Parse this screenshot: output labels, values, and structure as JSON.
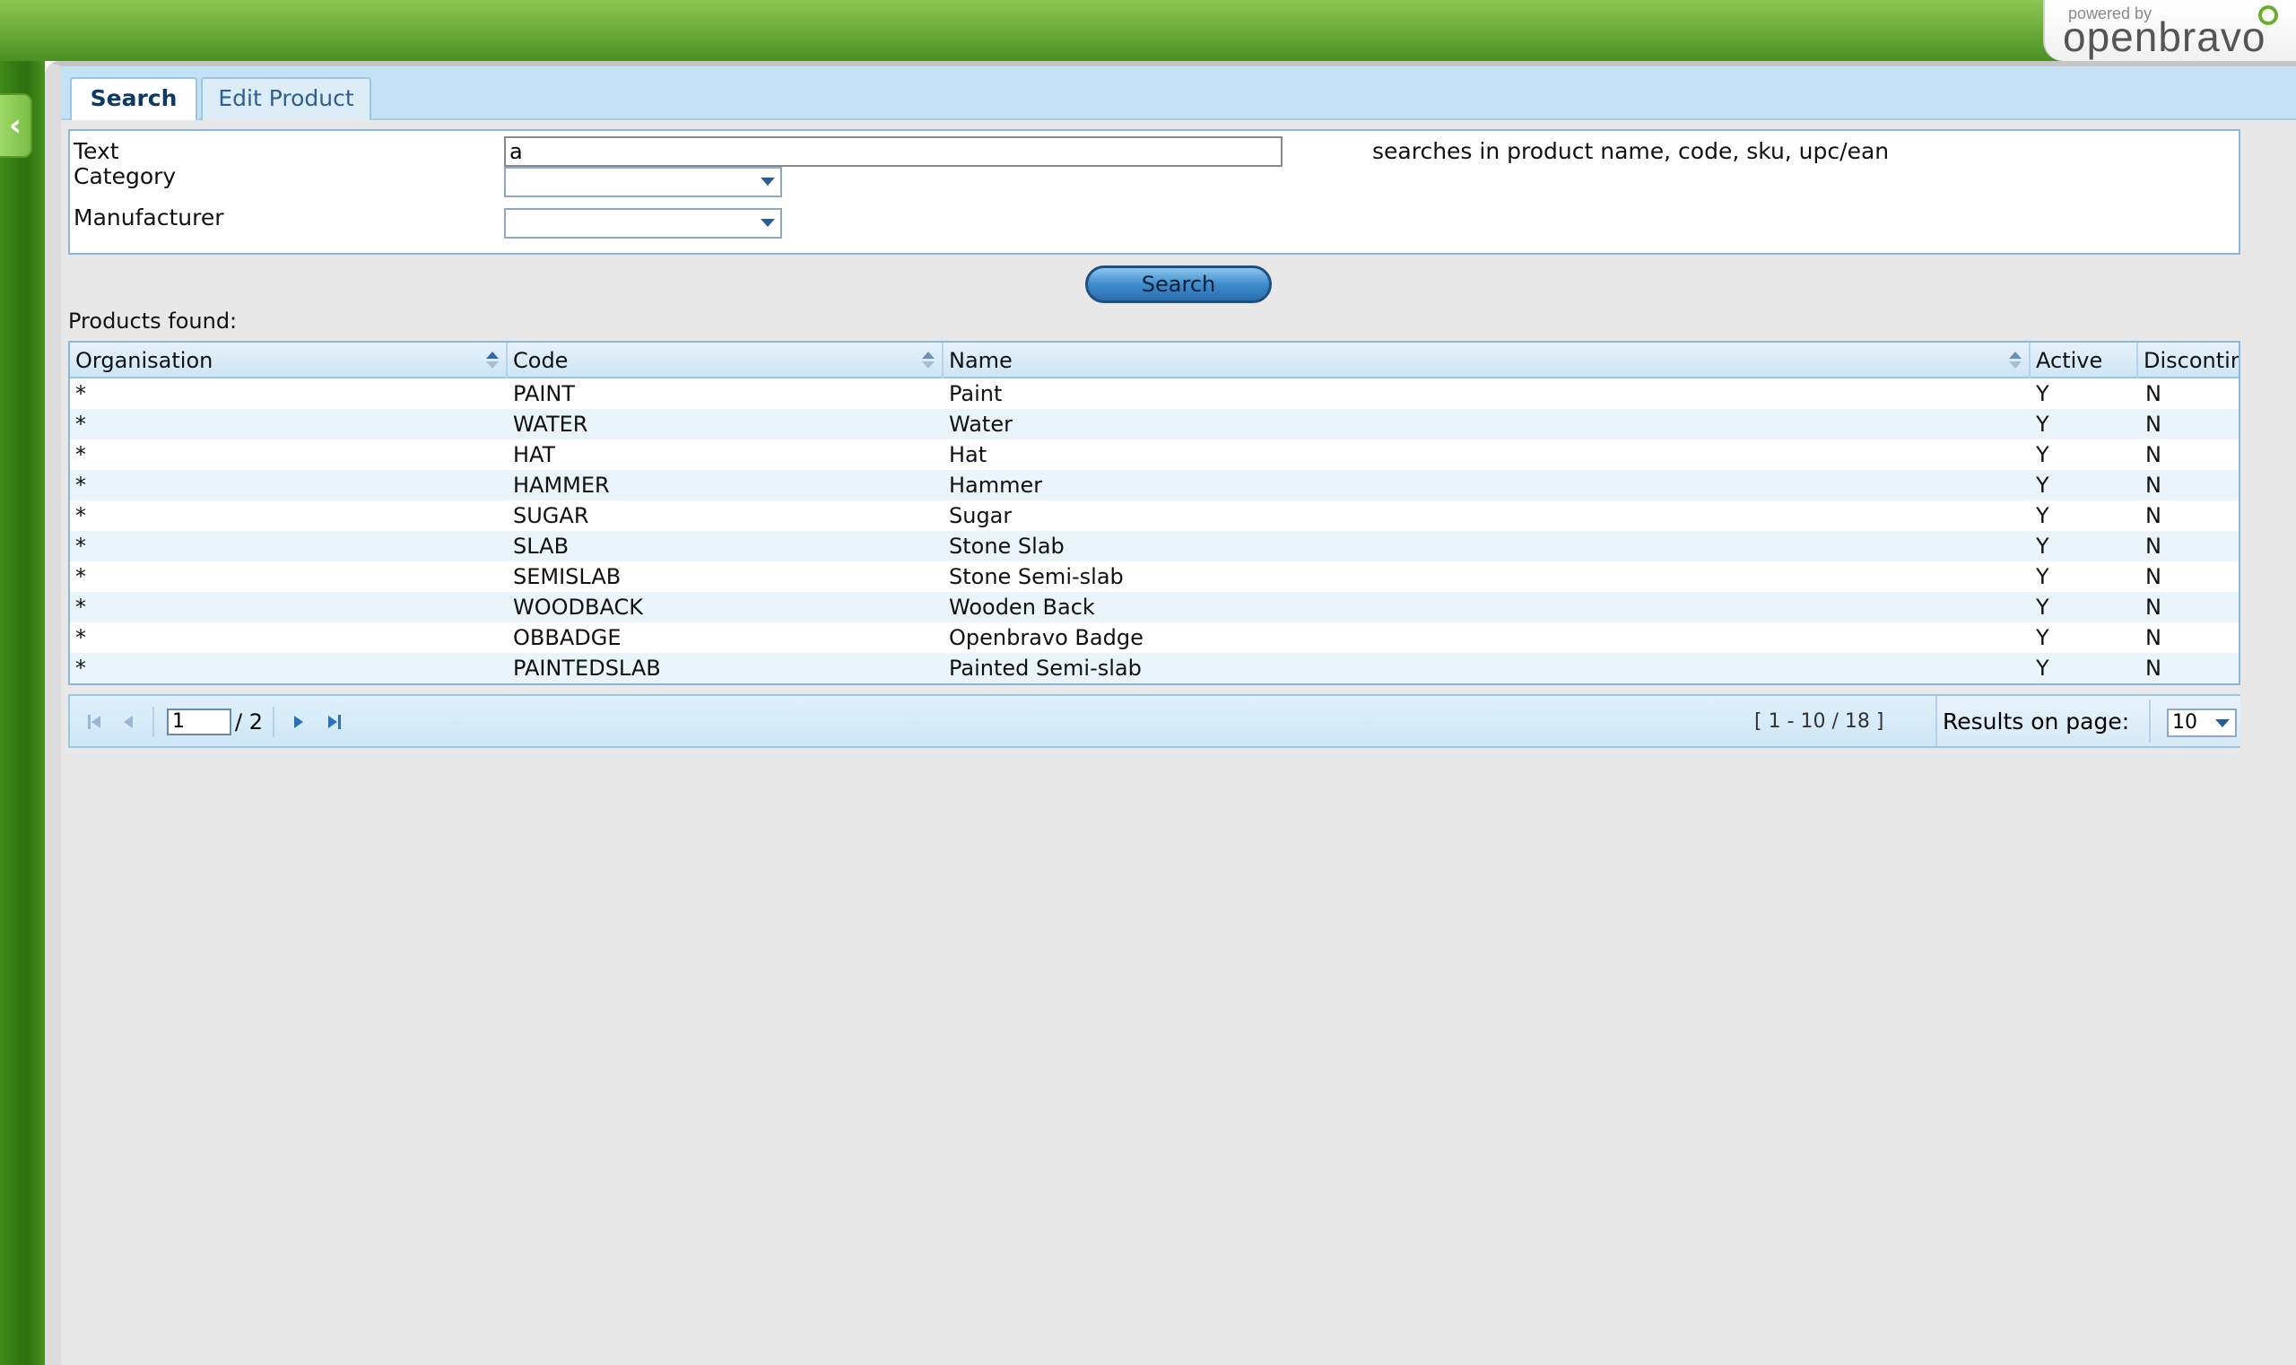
{
  "brand": {
    "powered_by": "powered by",
    "name": "openbravo"
  },
  "tabs": [
    {
      "label": "Search",
      "active": true
    },
    {
      "label": "Edit Product",
      "active": false
    }
  ],
  "form": {
    "text_label": "Text",
    "text_value": "a",
    "category_label": "Category",
    "category_value": "",
    "manufacturer_label": "Manufacturer",
    "manufacturer_value": "",
    "hint": "searches in product name, code, sku, upc/ean",
    "search_button": "Search"
  },
  "results_label": "Products found:",
  "table": {
    "columns": [
      "Organisation",
      "Code",
      "Name",
      "Active",
      "Discontin"
    ],
    "rows": [
      [
        "*",
        "PAINT",
        "Paint",
        "Y",
        "N"
      ],
      [
        "*",
        "WATER",
        "Water",
        "Y",
        "N"
      ],
      [
        "*",
        "HAT",
        "Hat",
        "Y",
        "N"
      ],
      [
        "*",
        "HAMMER",
        "Hammer",
        "Y",
        "N"
      ],
      [
        "*",
        "SUGAR",
        "Sugar",
        "Y",
        "N"
      ],
      [
        "*",
        "SLAB",
        "Stone Slab",
        "Y",
        "N"
      ],
      [
        "*",
        "SEMISLAB",
        "Stone Semi-slab",
        "Y",
        "N"
      ],
      [
        "*",
        "WOODBACK",
        "Wooden Back",
        "Y",
        "N"
      ],
      [
        "*",
        "OBBADGE",
        "Openbravo Badge",
        "Y",
        "N"
      ],
      [
        "*",
        "PAINTEDSLAB",
        "Painted Semi-slab",
        "Y",
        "N"
      ]
    ]
  },
  "pager": {
    "current_page": "1",
    "total_pages": "/ 2",
    "range": "[ 1 - 10 / 18 ]",
    "results_label": "Results on page:",
    "results_value": "10"
  },
  "colors": {
    "top_bar": "#6fae3a",
    "tab_strip": "#c4e2f5",
    "accent_blue": "#2a72b8"
  }
}
